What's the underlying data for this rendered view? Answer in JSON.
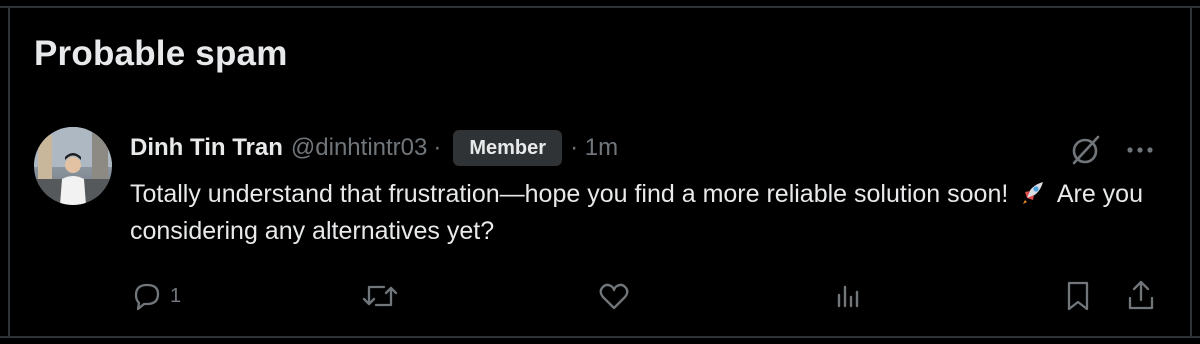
{
  "section": {
    "title": "Probable spam"
  },
  "post": {
    "author_name": "Dinh Tin Tran",
    "handle": "@dinhtintr03",
    "separator": "·",
    "badge": "Member",
    "time": "· 1m",
    "text_before_emoji": "Totally understand that frustration—hope you find a more reliable solution soon!",
    "text_after_emoji": "Are you considering any alternatives yet?",
    "emoji": "rocket"
  },
  "actions": {
    "reply_count": "1",
    "icons": [
      "reply-icon",
      "repost-icon",
      "like-icon",
      "views-icon",
      "bookmark-icon",
      "share-icon"
    ]
  },
  "colors": {
    "background": "#000000",
    "text": "#e7e9ea",
    "muted": "#71767b",
    "border": "#2f3336",
    "badge_bg": "#2f3336"
  }
}
